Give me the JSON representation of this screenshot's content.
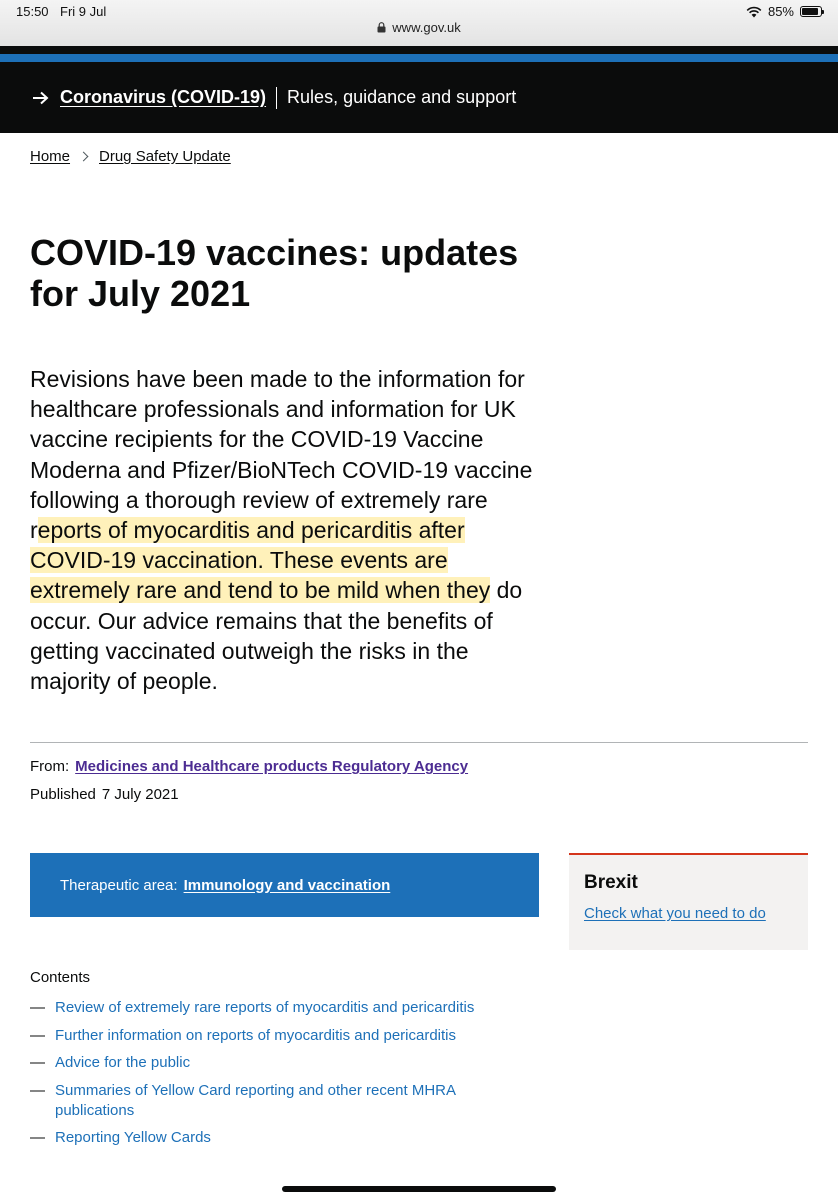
{
  "status_bar": {
    "time": "15:50",
    "date": "Fri 9 Jul",
    "battery": "85%",
    "url": "www.gov.uk"
  },
  "covid_banner": {
    "link": "Coronavirus (COVID-19)",
    "text": "Rules, guidance and support"
  },
  "breadcrumb": {
    "items": [
      "Home",
      "Drug Safety Update"
    ]
  },
  "page": {
    "title": "COVID-19 vaccines: updates for July 2021",
    "lead_before": "Revisions have been made to the information for healthcare professionals and information for UK vaccine recipients for the COVID-19 Vaccine Moderna and Pfizer/BioNTech COVID-19 vaccine following a thorough review of extremely rare r",
    "lead_highlight": "eports of myocarditis and pericarditis after COVID-19 vaccination. These events are extremely rare and tend to be mild when they",
    "lead_after": " do occur. Our advice remains that the benefits of getting vaccinated outweigh the risks in the majority of people."
  },
  "metadata": {
    "from_label": "From:",
    "from_value": "Medicines and Healthcare products Regulatory Agency",
    "published_label": "Published",
    "published_value": "7 July 2021"
  },
  "therapeutic_area": {
    "label": "Therapeutic area:",
    "value": "Immunology and vaccination"
  },
  "brexit": {
    "title": "Brexit",
    "link": "Check what you need to do"
  },
  "contents": {
    "heading": "Contents",
    "items": [
      "Review of extremely rare reports of myocarditis and pericarditis",
      "Further information on reports of myocarditis and pericarditis",
      "Advice for the public",
      "Summaries of Yellow Card reporting and other recent MHRA publications",
      "Reporting Yellow Cards"
    ]
  },
  "colors": {
    "govuk_black": "#0b0c0c",
    "govuk_blue": "#1d70b8",
    "visited_purple": "#4c2c92",
    "brexit_red": "#d4351c",
    "highlight_yellow": "#ffdd5a"
  }
}
